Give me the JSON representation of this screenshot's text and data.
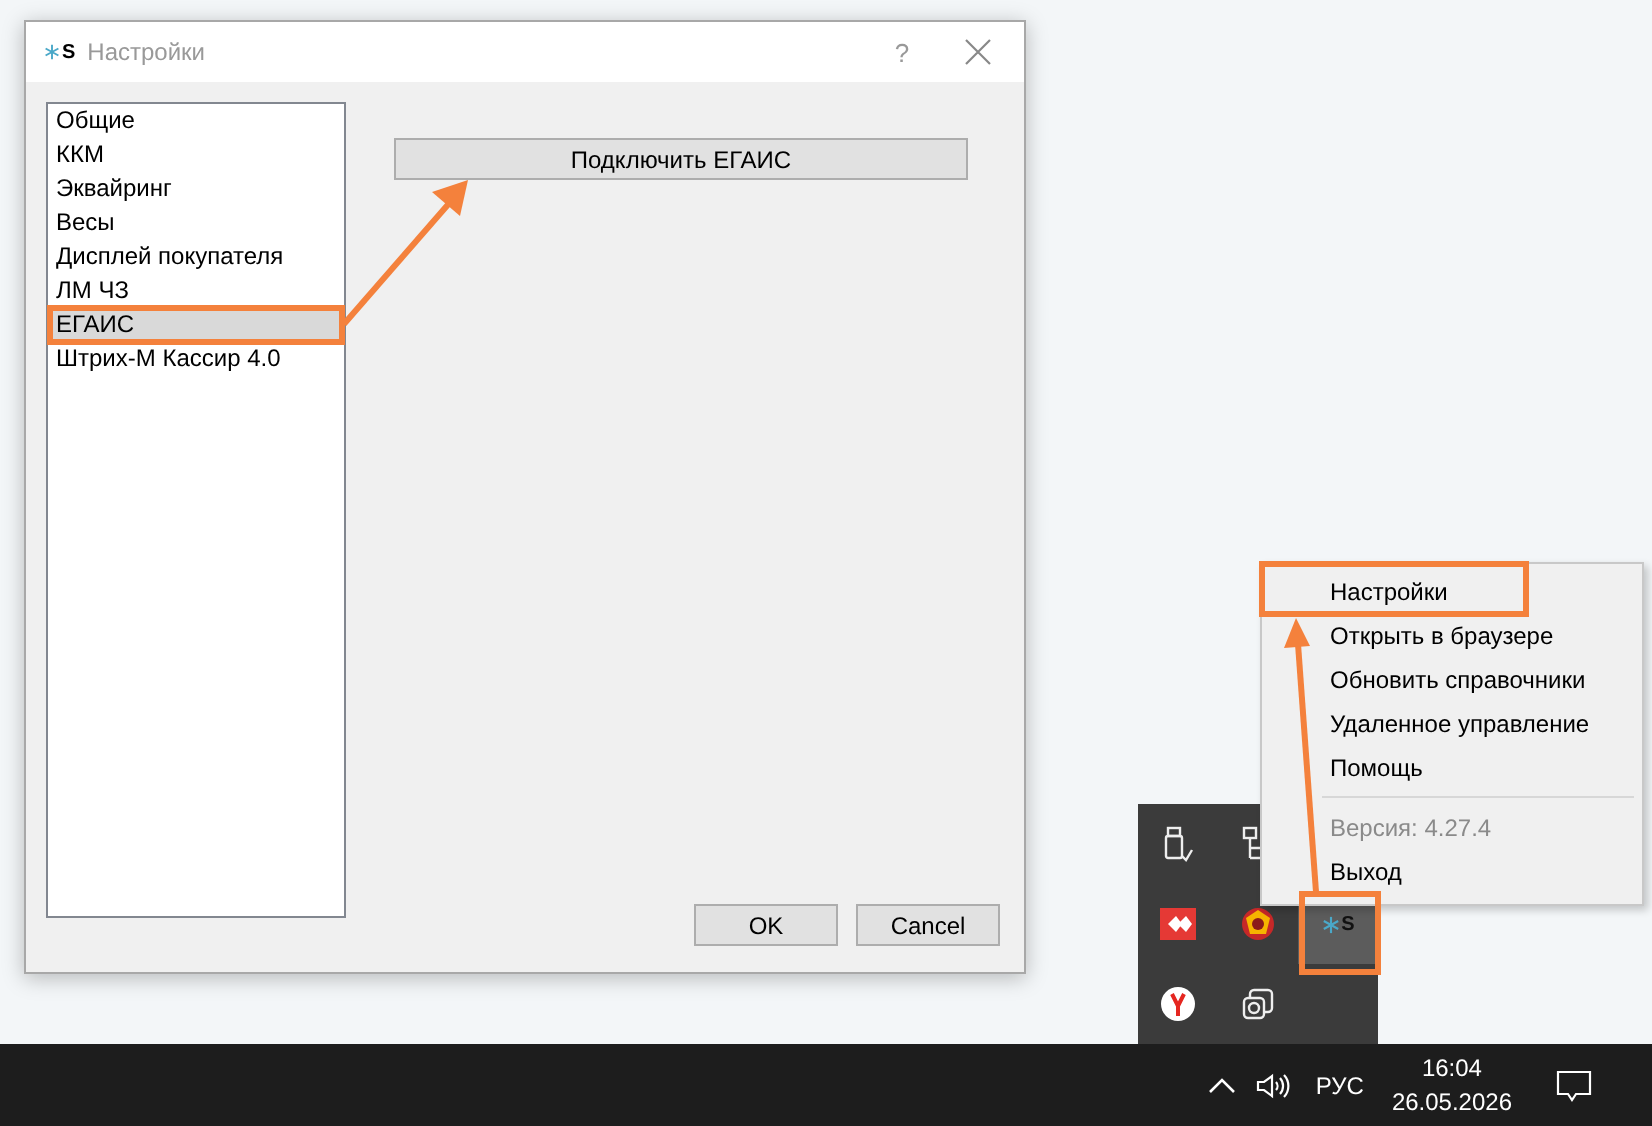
{
  "window": {
    "title": "Настройки",
    "icon_letter": "S",
    "help": "?"
  },
  "settings_list": [
    {
      "label": "Общие",
      "selected": false
    },
    {
      "label": "ККМ",
      "selected": false
    },
    {
      "label": "Эквайринг",
      "selected": false
    },
    {
      "label": "Весы",
      "selected": false
    },
    {
      "label": "Дисплей покупателя",
      "selected": false
    },
    {
      "label": "ЛМ ЧЗ",
      "selected": false
    },
    {
      "label": "ЕГАИС",
      "selected": true
    },
    {
      "label": "Штрих-М Кассир 4.0",
      "selected": false
    }
  ],
  "connect_button": "Подключить ЕГАИС",
  "dialog_buttons": [
    "OK",
    "Cancel"
  ],
  "context_menu": [
    {
      "kind": "item",
      "label": "Настройки",
      "disabled": false
    },
    {
      "kind": "item",
      "label": "Открыть в браузере",
      "disabled": false
    },
    {
      "kind": "item",
      "label": "Обновить справочники",
      "disabled": false
    },
    {
      "kind": "item",
      "label": "Удаленное управление",
      "disabled": false
    },
    {
      "kind": "item",
      "label": "Помощь",
      "disabled": false
    },
    {
      "kind": "separator"
    },
    {
      "kind": "item",
      "label": "Версия: 4.27.4",
      "disabled": true
    },
    {
      "kind": "item",
      "label": "Выход",
      "disabled": false
    }
  ],
  "tray": {
    "app_icon_letter": "S"
  },
  "taskbar": {
    "language": "РУС",
    "time": "16:04",
    "date": "26.05.2026"
  }
}
